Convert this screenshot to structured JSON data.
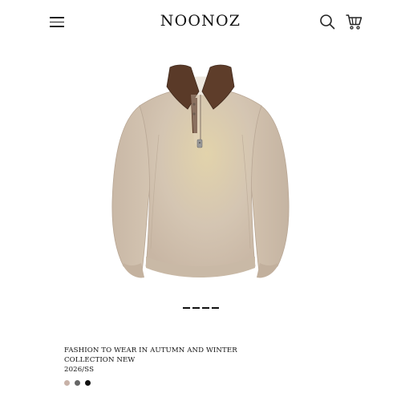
{
  "header": {
    "brand": "NOONOZ",
    "icons": {
      "menu": "hamburger-menu-icon",
      "search": "search-icon",
      "cart": "shopping-cart-icon"
    }
  },
  "product": {
    "image": "beige zip polo sweater with brown collar",
    "caption_line1": "FASHION TO WEAR IN AUTUMN AND WINTER",
    "caption_line2": "COLLECTION NEW",
    "caption_line3": "2026/SS",
    "colors": [
      "#c8b2a8",
      "#666666",
      "#111111"
    ]
  },
  "carousel": {
    "count": 4
  }
}
